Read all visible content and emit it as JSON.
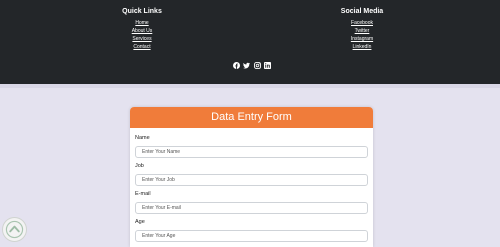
{
  "footer": {
    "quick_links": {
      "heading": "Quick Links",
      "items": [
        {
          "label": "Home"
        },
        {
          "label": "About Us"
        },
        {
          "label": "Services"
        },
        {
          "label": "Contact"
        }
      ]
    },
    "social_media": {
      "heading": "Social Media",
      "items": [
        {
          "label": "Facebook"
        },
        {
          "label": "Twitter"
        },
        {
          "label": "Instagram"
        },
        {
          "label": "LinkedIn"
        }
      ]
    },
    "social_icons": [
      "facebook-icon",
      "twitter-icon",
      "instagram-icon",
      "linkedin-icon"
    ],
    "background_color": "#232629"
  },
  "form": {
    "title": "Data Entry Form",
    "header_color": "#f07c3a",
    "fields": [
      {
        "label": "Name",
        "placeholder": "Enter Your Name",
        "value": ""
      },
      {
        "label": "Job",
        "placeholder": "Enter Your Job",
        "value": ""
      },
      {
        "label": "E-mail",
        "placeholder": "Enter Your E-mail",
        "value": ""
      },
      {
        "label": "Age",
        "placeholder": "Enter Your Age",
        "value": ""
      }
    ]
  },
  "scroll_button": {
    "icon": "chevron-up-icon"
  }
}
